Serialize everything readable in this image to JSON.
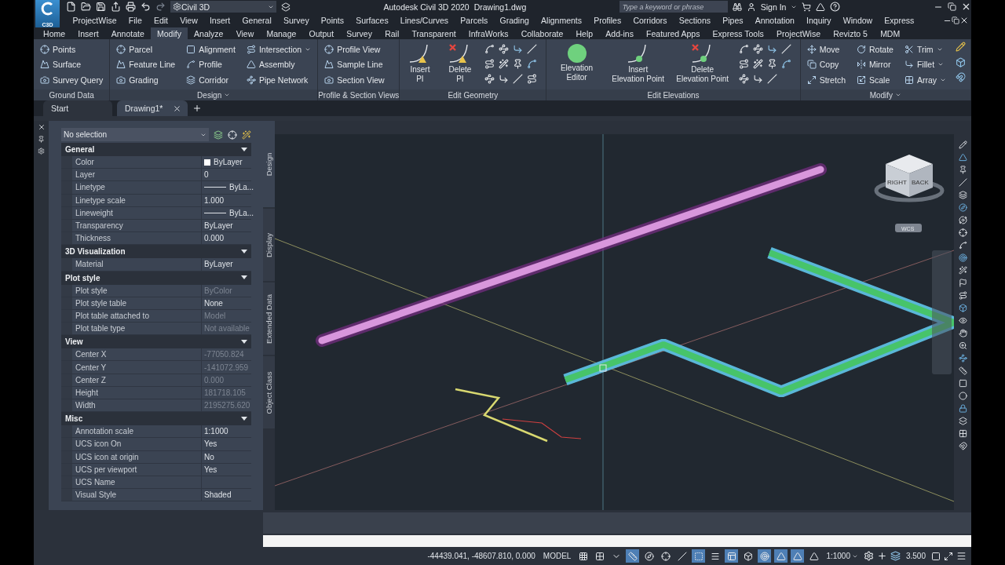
{
  "title_bar": {
    "app_badge": "C3D",
    "workspace": "Civil 3D",
    "app_title": "Autodesk Civil 3D 2020",
    "document": "Drawing1.dwg",
    "search": {
      "placeholder": "Type a keyword or phrase"
    },
    "sign_in": "Sign In"
  },
  "menu_bar": [
    "ProjectWise",
    "File",
    "Edit",
    "View",
    "Insert",
    "General",
    "Survey",
    "Points",
    "Surfaces",
    "Lines/Curves",
    "Parcels",
    "Grading",
    "Alignments",
    "Profiles",
    "Corridors",
    "Sections",
    "Pipes",
    "Annotation",
    "Inquiry",
    "Window",
    "Express"
  ],
  "ribbon_tabs": [
    {
      "label": "Home",
      "selected": false
    },
    {
      "label": "Insert",
      "selected": false
    },
    {
      "label": "Annotate",
      "selected": false
    },
    {
      "label": "Modify",
      "selected": true
    },
    {
      "label": "Analyze",
      "selected": false
    },
    {
      "label": "View",
      "selected": false
    },
    {
      "label": "Manage",
      "selected": false
    },
    {
      "label": "Output",
      "selected": false
    },
    {
      "label": "Survey",
      "selected": false
    },
    {
      "label": "Rail",
      "selected": false
    },
    {
      "label": "Transparent",
      "selected": false
    },
    {
      "label": "InfraWorks",
      "selected": false
    },
    {
      "label": "Collaborate",
      "selected": false
    },
    {
      "label": "Help",
      "selected": false
    },
    {
      "label": "Add-ins",
      "selected": false
    },
    {
      "label": "Featured Apps",
      "selected": false
    },
    {
      "label": "Express Tools",
      "selected": false
    },
    {
      "label": "ProjectWise",
      "selected": false
    },
    {
      "label": "Revizto 5",
      "selected": false
    },
    {
      "label": "MDM",
      "selected": false
    }
  ],
  "ribbon_panels": [
    {
      "title": "Ground Data",
      "dropdown": false,
      "kind": "list",
      "tools": [
        {
          "label": "Points",
          "dropdown": false
        },
        {
          "label": "Surface",
          "dropdown": false
        },
        {
          "label": "Survey Query",
          "dropdown": false
        }
      ]
    },
    {
      "title": "Design",
      "dropdown": true,
      "kind": "list",
      "tools": [
        {
          "label": "Parcel",
          "dropdown": false
        },
        {
          "label": "Feature Line",
          "dropdown": false
        },
        {
          "label": "Grading",
          "dropdown": false
        },
        {
          "label": "Alignment",
          "dropdown": false
        },
        {
          "label": "Profile",
          "dropdown": false
        },
        {
          "label": "Corridor",
          "dropdown": false
        },
        {
          "label": "Intersection",
          "dropdown": true
        },
        {
          "label": "Assembly",
          "dropdown": false
        },
        {
          "label": "Pipe Network",
          "dropdown": false
        }
      ]
    },
    {
      "title": "Profile & Section Views",
      "dropdown": false,
      "kind": "list",
      "tools": [
        {
          "label": "Profile View",
          "dropdown": false
        },
        {
          "label": "Sample Line",
          "dropdown": false
        },
        {
          "label": "Section View",
          "dropdown": false
        }
      ]
    },
    {
      "title": "Edit Geometry",
      "dropdown": false,
      "kind": "large",
      "tools": [
        {
          "label": "Insert PI",
          "dropdown": false
        },
        {
          "label": "Delete PI",
          "dropdown": false
        }
      ]
    },
    {
      "title": "Edit Elevations",
      "dropdown": false,
      "kind": "large",
      "tools": [
        {
          "label": "Elevation Editor",
          "dropdown": false
        },
        {
          "label": "Insert Elevation Point",
          "dropdown": false
        },
        {
          "label": "Delete Elevation Point",
          "dropdown": false
        }
      ]
    },
    {
      "title": "Modify",
      "dropdown": true,
      "kind": "list",
      "tools": [
        {
          "label": "Move",
          "dropdown": false
        },
        {
          "label": "Copy",
          "dropdown": false
        },
        {
          "label": "Stretch",
          "dropdown": false
        },
        {
          "label": "Rotate",
          "dropdown": false
        },
        {
          "label": "Mirror",
          "dropdown": false
        },
        {
          "label": "Scale",
          "dropdown": false
        },
        {
          "label": "Trim",
          "dropdown": true
        },
        {
          "label": "Fillet",
          "dropdown": true
        },
        {
          "label": "Array",
          "dropdown": true
        }
      ]
    }
  ],
  "document_tabs": [
    {
      "label": "Start",
      "selected": false,
      "closable": false
    },
    {
      "label": "Drawing1*",
      "selected": true,
      "closable": true
    }
  ],
  "properties": {
    "selection": "No selection",
    "sections": [
      {
        "title": "General",
        "expanded": true,
        "rows": [
          {
            "kind": "swatch",
            "label": "Color",
            "value": "ByLayer",
            "dimmed": false
          },
          {
            "kind": "text",
            "label": "Layer",
            "value": "0",
            "dimmed": false
          },
          {
            "kind": "line",
            "label": "Linetype",
            "value": "ByLa...",
            "dimmed": false
          },
          {
            "kind": "text",
            "label": "Linetype scale",
            "value": "1.000",
            "dimmed": false
          },
          {
            "kind": "line",
            "label": "Lineweight",
            "value": "ByLa...",
            "dimmed": false
          },
          {
            "kind": "text",
            "label": "Transparency",
            "value": "ByLayer",
            "dimmed": false
          },
          {
            "kind": "text",
            "label": "Thickness",
            "value": "0.000",
            "dimmed": false
          }
        ]
      },
      {
        "title": "3D Visualization",
        "expanded": true,
        "rows": [
          {
            "kind": "text",
            "label": "Material",
            "value": "ByLayer",
            "dimmed": false
          }
        ]
      },
      {
        "title": "Plot style",
        "expanded": true,
        "rows": [
          {
            "kind": "text",
            "label": "Plot style",
            "value": "ByColor",
            "dimmed": true
          },
          {
            "kind": "text",
            "label": "Plot style table",
            "value": "None",
            "dimmed": false
          },
          {
            "kind": "text",
            "label": "Plot table attached to",
            "value": "Model",
            "dimmed": true
          },
          {
            "kind": "text",
            "label": "Plot table type",
            "value": "Not available",
            "dimmed": true
          }
        ]
      },
      {
        "title": "View",
        "expanded": true,
        "rows": [
          {
            "kind": "text",
            "label": "Center X",
            "value": "-77050.824",
            "dimmed": true
          },
          {
            "kind": "text",
            "label": "Center Y",
            "value": "-141072.959",
            "dimmed": true
          },
          {
            "kind": "text",
            "label": "Center Z",
            "value": "0.000",
            "dimmed": true
          },
          {
            "kind": "text",
            "label": "Height",
            "value": "181718.105",
            "dimmed": true
          },
          {
            "kind": "text",
            "label": "Width",
            "value": "2195275.620",
            "dimmed": true
          }
        ]
      },
      {
        "title": "Misc",
        "expanded": true,
        "rows": [
          {
            "kind": "text",
            "label": "Annotation scale",
            "value": "1:1000",
            "dimmed": false
          },
          {
            "kind": "text",
            "label": "UCS icon On",
            "value": "Yes",
            "dimmed": false
          },
          {
            "kind": "text",
            "label": "UCS icon at origin",
            "value": "No",
            "dimmed": false
          },
          {
            "kind": "text",
            "label": "UCS per viewport",
            "value": "Yes",
            "dimmed": false
          },
          {
            "kind": "text",
            "label": "UCS Name"
          },
          {
            "kind": "text",
            "label": "Visual Style",
            "value": "Shaded",
            "dimmed": false
          }
        ]
      }
    ]
  },
  "palette_tabs": [
    {
      "label": "Design",
      "selected": true
    },
    {
      "label": "Display",
      "selected": false
    },
    {
      "label": "Extended Data",
      "selected": false
    },
    {
      "label": "Object Class",
      "selected": false
    }
  ],
  "viewport": {
    "view_cube": {
      "faces": [
        "RIGHT",
        "BACK"
      ],
      "wcs": "WCS"
    }
  },
  "status_bar": {
    "coordinates": "-44439.041, -48607.810, 0.000",
    "space": "MODEL",
    "toggles": [
      {
        "on": false
      },
      {
        "on": false
      },
      {
        "on": false
      },
      {
        "on": true
      },
      {
        "on": false
      },
      {
        "on": false
      },
      {
        "on": false
      },
      {
        "on": true
      },
      {
        "on": false
      },
      {
        "on": true
      },
      {
        "on": false
      },
      {
        "on": true
      },
      {
        "on": true
      },
      {
        "on": true
      },
      {
        "on": false
      }
    ],
    "scale": "1:1000",
    "value": "3.500"
  }
}
